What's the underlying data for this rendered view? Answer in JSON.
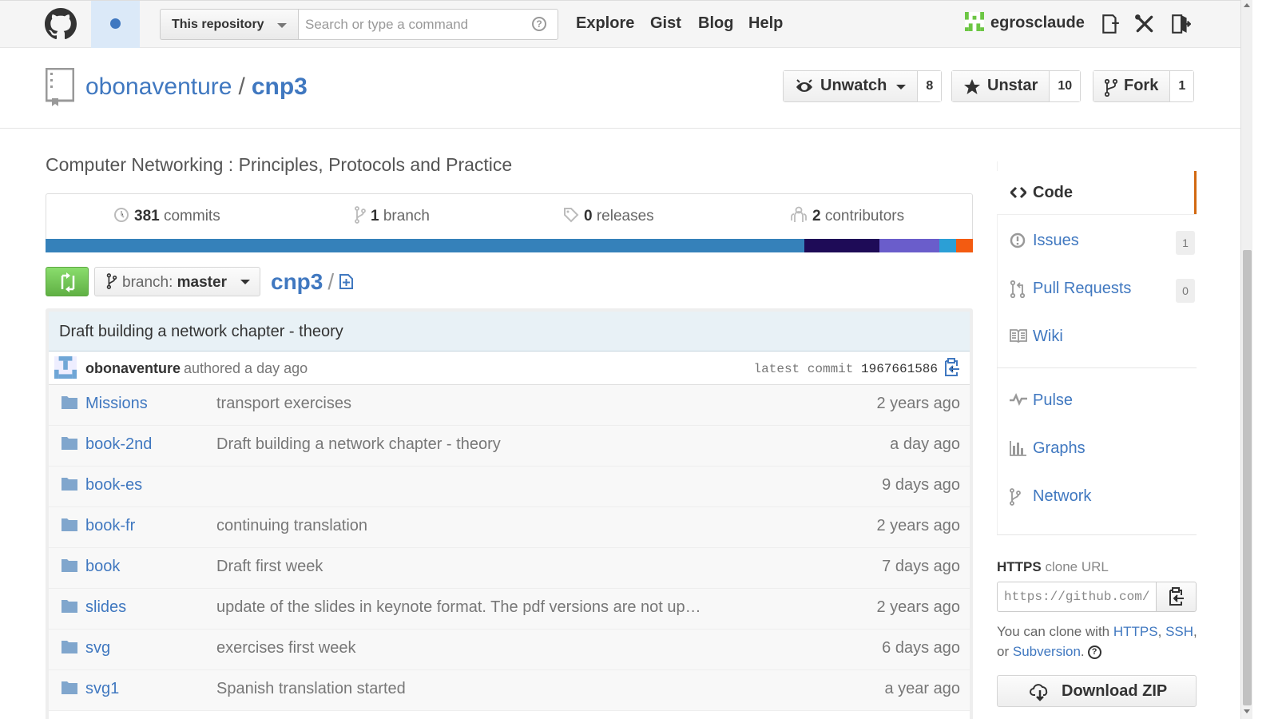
{
  "header": {
    "scope_label": "This repository",
    "search_placeholder": "Search or type a command",
    "nav": [
      "Explore",
      "Gist",
      "Blog",
      "Help"
    ],
    "username": "egrosclaude"
  },
  "repo": {
    "owner": "obonaventure",
    "separator": "/",
    "name": "cnp3",
    "description": "Computer Networking : Principles, Protocols and Practice",
    "watch_label": "Unwatch",
    "watch_count": "8",
    "star_label": "Unstar",
    "star_count": "10",
    "fork_label": "Fork",
    "fork_count": "1"
  },
  "summary": {
    "commits_count": "381",
    "commits_label": "commits",
    "branches_count": "1",
    "branches_label": "branch",
    "releases_count": "0",
    "releases_label": "releases",
    "contributors_count": "2",
    "contributors_label": "contributors"
  },
  "language_colors": [
    "#3581ba",
    "#1e0b57",
    "#6a5dcb",
    "#2b9fd6",
    "#f35b11"
  ],
  "language_fractions": [
    0.818,
    0.081,
    0.065,
    0.018,
    0.018
  ],
  "branch": {
    "prefix": "branch:",
    "name": "master",
    "crumb": "cnp3",
    "crumb_sep": "/"
  },
  "commit": {
    "title": "Draft building a network chapter - theory",
    "author": "obonaventure",
    "when": "authored a day ago",
    "latest_label": "latest commit",
    "sha": "1967661586"
  },
  "files": [
    {
      "name": "Missions",
      "message": "transport exercises",
      "age": "2 years ago"
    },
    {
      "name": "book-2nd",
      "message": "Draft building a network chapter - theory",
      "age": "a day ago"
    },
    {
      "name": "book-es",
      "message": "",
      "age": "9 days ago"
    },
    {
      "name": "book-fr",
      "message": "continuing translation",
      "age": "2 years ago"
    },
    {
      "name": "book",
      "message": "Draft first week",
      "age": "7 days ago"
    },
    {
      "name": "slides",
      "message": "update of the slides in keynote format. The pdf versions are not up t…",
      "age": "2 years ago"
    },
    {
      "name": "svg",
      "message": "exercises first week",
      "age": "6 days ago"
    },
    {
      "name": "svg1",
      "message": "Spanish translation started",
      "age": "a year ago"
    }
  ],
  "sidebar": {
    "code": "Code",
    "issues": "Issues",
    "issues_count": "1",
    "pulls": "Pull Requests",
    "pulls_count": "0",
    "wiki": "Wiki",
    "pulse": "Pulse",
    "graphs": "Graphs",
    "network": "Network"
  },
  "clone": {
    "protocol": "HTTPS",
    "label_suffix": "clone URL",
    "url": "https://github.com/",
    "help_prefix": "You can clone with",
    "https": "HTTPS",
    "comma": ",",
    "ssh": "SSH",
    "or": ", or",
    "subversion": "Subversion",
    "period": ".",
    "help_icon": "?",
    "download": "Download ZIP"
  },
  "icons": {
    "logo": "octocat-icon",
    "repo": "repo-icon",
    "watch": "eye-icon",
    "star": "star-icon",
    "fork": "fork-icon",
    "folder": "folder-icon",
    "clipboard": "clipboard-icon"
  },
  "colors": {
    "link": "#4078c0",
    "compare_green": "#60b044",
    "code_tab_accent": "#d26911",
    "commit_header_bg": "#e8f1f6"
  }
}
